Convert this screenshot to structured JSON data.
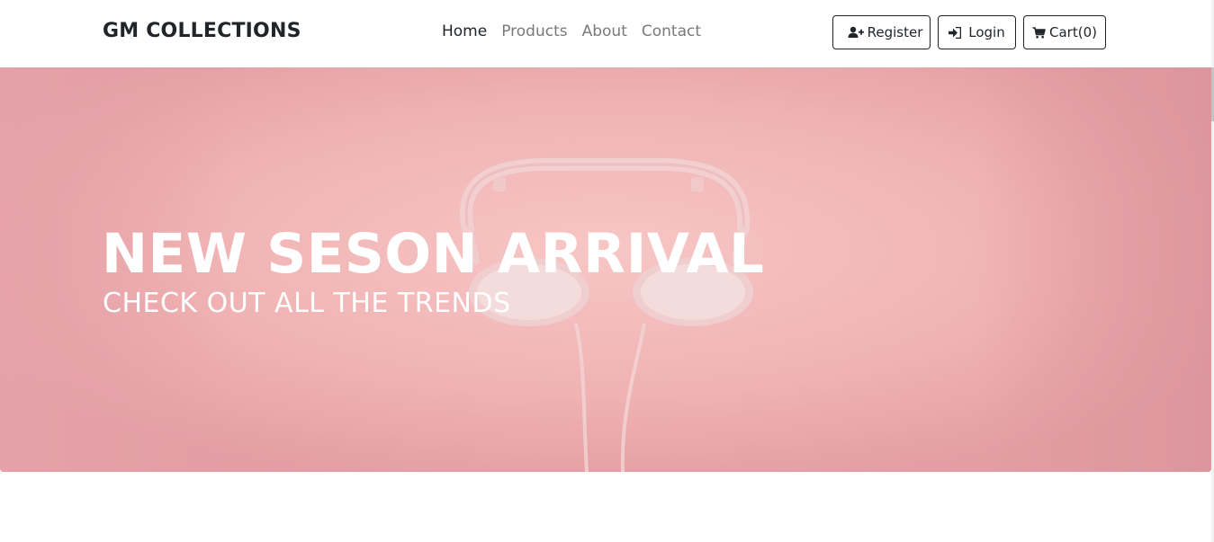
{
  "brand": "GM COLLECTIONS",
  "nav": {
    "links": [
      {
        "label": "Home",
        "active": true
      },
      {
        "label": "Products",
        "active": false
      },
      {
        "label": "About",
        "active": false
      },
      {
        "label": "Contact",
        "active": false
      }
    ]
  },
  "buttons": {
    "register": {
      "label": "Register",
      "icon": "user-plus-icon"
    },
    "login": {
      "label": "Login",
      "icon": "sign-in-icon"
    },
    "cart": {
      "label": "Cart(0)",
      "icon": "cart-icon"
    }
  },
  "hero": {
    "title": "NEW SESON ARRIVAL",
    "subtitle": "CHECK OUT ALL THE TRENDS",
    "image": "pink-headphones-background"
  },
  "colors": {
    "text_dark": "#212529",
    "nav_muted": "#7a7a7a",
    "hero_pink": "#f2b6b5",
    "white": "#ffffff"
  }
}
